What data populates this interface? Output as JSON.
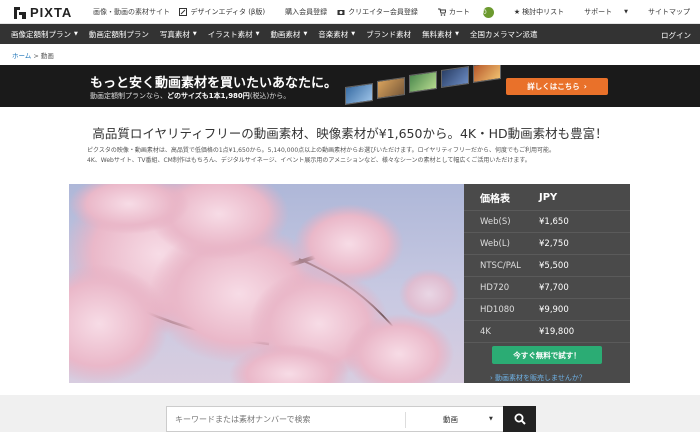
{
  "header": {
    "logo_text": "PIXTA",
    "tagline": "画像・動画の素材サイト",
    "links": {
      "design_editor": "デザインエディタ (β版)",
      "buyer_register": "購入会員登録",
      "creator_register": "クリエイター会員登録",
      "cart": "カート",
      "cart_count": "0",
      "history": "検討中リスト",
      "support": "サポート",
      "sitemap": "サイトマップ"
    }
  },
  "nav": {
    "items": [
      "画像定額制プラン",
      "動画定額制プラン",
      "写真素材",
      "イラスト素材",
      "動画素材",
      "音楽素材",
      "ブランド素材",
      "無料素材",
      "全国カメラマン派遣"
    ],
    "login": "ログイン"
  },
  "breadcrumb": {
    "home": "ホーム",
    "sep": ">",
    "current": "動画"
  },
  "banner": {
    "headline": "もっと安く動画素材を買いたいあなたに。",
    "sub_prefix": "動画定額制プランなら、",
    "sub_bold": "どのサイズも1本1,980円",
    "sub_suffix": "(税込)から。",
    "button": "詳しくはこちら"
  },
  "main": {
    "headline": "高品質ロイヤリティフリーの動画素材、映像素材が¥1,650から。4K・HD動画素材も豊富！",
    "desc_line1": "ピクスタの映像・動画素材は、高品質で低価格の1点¥1,650から。5,140,000点以上の動画素材からお選びいただけます。ロイヤリティフリーだから、何度でもご利用可能。",
    "desc_line2": "4K、Webサイト、TV番組、CM制作はもちろん、デジタルサイネージ、イベント展示用のアメニションなど、様々なシーンの素材として幅広くご活用いただけます。"
  },
  "price_table": {
    "header_left": "価格表",
    "header_right": "JPY",
    "rows": [
      {
        "size": "Web(S)",
        "price": "¥1,650"
      },
      {
        "size": "Web(L)",
        "price": "¥2,750"
      },
      {
        "size": "NTSC/PAL",
        "price": "¥5,500"
      },
      {
        "size": "HD720",
        "price": "¥7,700"
      },
      {
        "size": "HD1080",
        "price": "¥9,900"
      },
      {
        "size": "4K",
        "price": "¥19,800"
      }
    ],
    "cta": "今すぐ無料で試す！",
    "sell_link": "› 動画素材を販売しませんか？"
  },
  "search": {
    "placeholder": "キーワードまたは素材ナンバーで検索",
    "category": "動画"
  },
  "colors": {
    "nav_bg": "#333333",
    "accent_orange": "#e9712a",
    "accent_green": "#2bac74",
    "link_blue": "#1b73b8"
  }
}
